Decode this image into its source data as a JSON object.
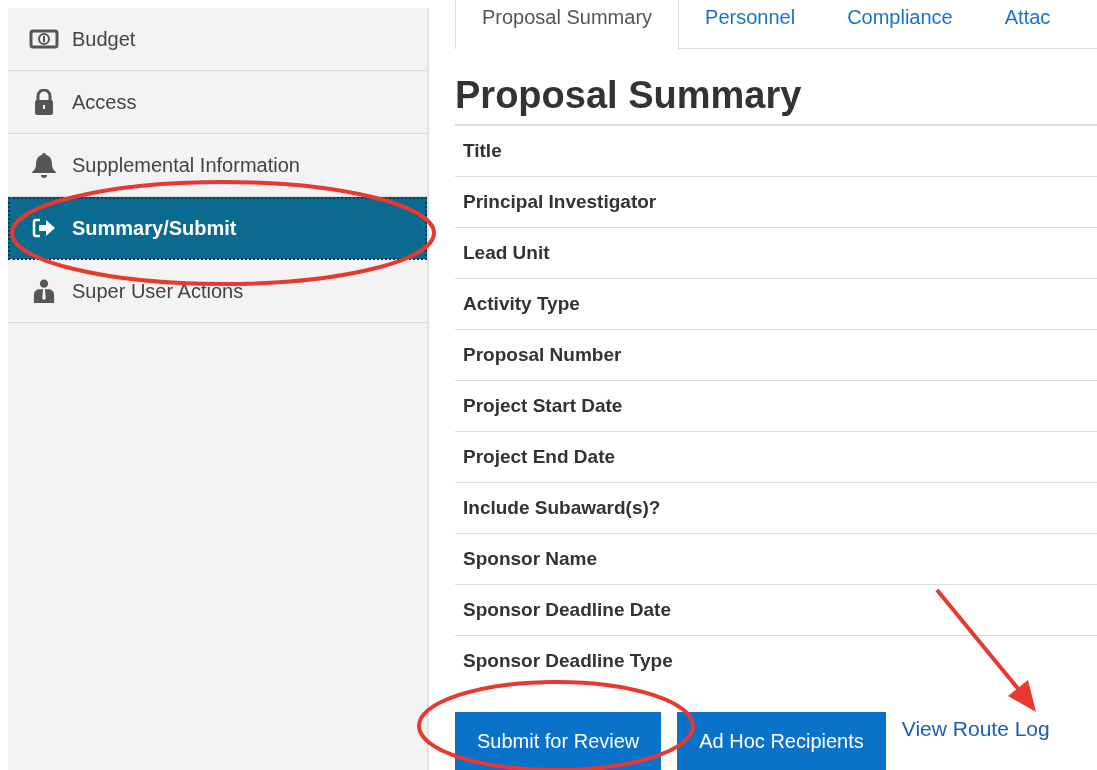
{
  "sidebar": {
    "items": [
      {
        "label": "Budget",
        "kind": "money",
        "selected": false
      },
      {
        "label": "Access",
        "kind": "lock",
        "selected": false
      },
      {
        "label": "Supplemental Information",
        "kind": "bell",
        "selected": false
      },
      {
        "label": "Summary/Submit",
        "kind": "signin",
        "selected": true
      },
      {
        "label": "Super User Actions",
        "kind": "user",
        "selected": false
      }
    ]
  },
  "tabs": [
    {
      "label": "Proposal Summary",
      "selected": true
    },
    {
      "label": "Personnel",
      "selected": false
    },
    {
      "label": "Compliance",
      "selected": false
    },
    {
      "label": "Attac",
      "selected": false
    }
  ],
  "heading": "Proposal Summary",
  "summary_rows": [
    "Title",
    "Principal Investigator",
    "Lead Unit",
    "Activity Type",
    "Proposal Number",
    "Project Start Date",
    "Project End Date",
    "Include Subaward(s)?",
    "Sponsor Name",
    "Sponsor Deadline Date",
    "Sponsor Deadline Type"
  ],
  "buttons": [
    "Submit for Review",
    "Ad Hoc Recipients"
  ],
  "link": "View Route Log"
}
